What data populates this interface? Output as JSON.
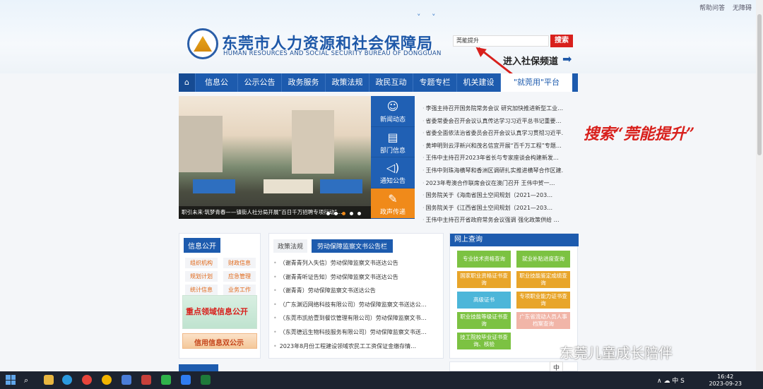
{
  "top_links": [
    "帮助问答",
    "无障碍"
  ],
  "logo": {
    "cn": "东莞市人力资源和社会保障局",
    "en": "HUMAN RESOURCES AND SOCIAL SECURITY BUREAU OF DONGGUAN"
  },
  "search": {
    "value": "莞能提升",
    "button": "搜索"
  },
  "shebao_link": "进入社保频道",
  "nav": [
    "信息公开",
    "公示公告",
    "政务服务",
    "政策法规",
    "政民互动",
    "专题专栏",
    "机关建设",
    "\"就莞用\"平台"
  ],
  "banner_caption": "职引未来·筑梦青春——镇街人社分局开展“百日千万招聘专项行动”…",
  "side_tabs": [
    {
      "label": "新闻动态",
      "icon": "people-icon"
    },
    {
      "label": "部门信息",
      "icon": "document-icon"
    },
    {
      "label": "通知公告",
      "icon": "speaker-icon"
    },
    {
      "label": "政声传递",
      "icon": "edit-icon"
    }
  ],
  "news": [
    "李强主持召开国务院常务会议 研究加快推进新型工业…",
    "省委常委会召开会议认真传达学习习近平总书记重要…",
    "省委全面依法治省委员会召开会议认真学习贯彻习近平…",
    "黄坤明到云浮新兴和茂名信宜开展“百千万工程”专题…",
    "王伟中主持召开2023年省长与专家座谈会构建新发…",
    "王伟中到珠海横琴和香洲区调研扎实推进横琴合作区建…",
    "2023年粤澳合作联席会议在澳门召开 王伟中贺一…",
    "国务院关于《海南省国土空间规划（2021—203…",
    "国务院关于《江西省国土空间规划（2021—203…",
    "王伟中主持召开省政府常务会议强调 强化政策供给 …"
  ],
  "annotation": "搜索“莞能提升”",
  "info_panel": {
    "title": "信息公开",
    "items": [
      "组织机构",
      "财政信息",
      "规划计划",
      "应急管理",
      "统计信息",
      "业务工作"
    ],
    "feature1": "重点领域信息公开",
    "feature2": "信用信息双公示"
  },
  "mid_panel": {
    "tab1": "政策法规",
    "tab2": "劳动保障监察文书公告栏",
    "items": [
      "（谢青青列入失信）劳动保障监察文书送达公告",
      "（谢青青听证告知）劳动保障监察文书送达公告",
      "（谢青青）劳动保障监察文书送达公告",
      "（广东渊迈网络科技有限公司）劳动保障监察文书送达公…",
      "（东莞市凯拾壹到餐饮管理有限公司）劳动保障监察文书…",
      "（东莞德远生物科技服务有限公司）劳动保障监察文书送…",
      "2023年8月份工程建设领域农民工工资保证金缴存情…"
    ]
  },
  "online_query": {
    "title": "网上查询",
    "buttons": [
      {
        "label": "专业技术资格查询",
        "color": "#7cc242"
      },
      {
        "label": "就业补贴进度查询",
        "color": "#7cc242"
      },
      {
        "label": "国家职业资格证书查询",
        "color": "#e8a52a"
      },
      {
        "label": "职业技能鉴定成绩查询",
        "color": "#e8a52a"
      },
      {
        "label": "高级证书",
        "color": "#4cb6d9"
      },
      {
        "label": "专项职业能力证书查询",
        "color": "#e8a52a"
      },
      {
        "label": "职业技能等级证书查询",
        "color": "#7cc242"
      },
      {
        "label": "广东省流动人员人事档案查询",
        "color": "#f1b5a8"
      },
      {
        "label": "技工院校毕业证书查询、核验",
        "color": "#7cc242"
      }
    ]
  },
  "watermark": "东莞儿童成长陪伴",
  "ime": "中",
  "clock": {
    "time": "16:42",
    "date": "2023-09-23"
  },
  "tray": "∧  ☁  中  S"
}
